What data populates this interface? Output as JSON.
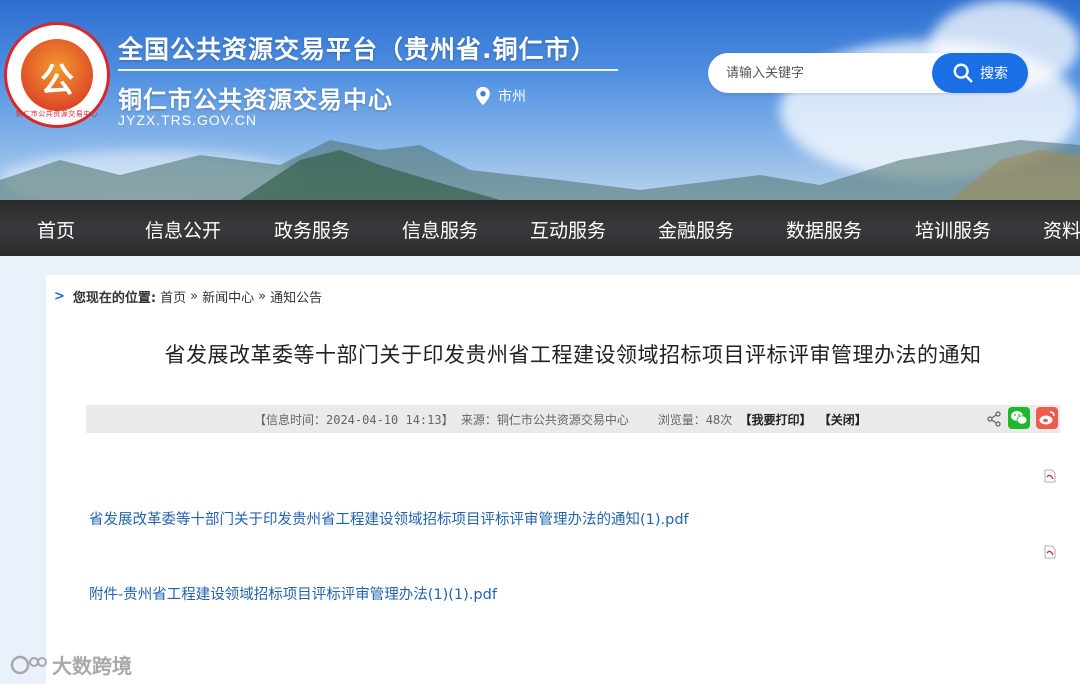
{
  "header": {
    "logo_char": "公",
    "logo_ring_text": "铜仁市公共资源交易中心",
    "title_main": "全国公共资源交易平台（贵州省.铜仁市）",
    "title_sub": "铜仁市公共资源交易中心",
    "domain": "JYZX.TRS.GOV.CN",
    "location_label": "市州",
    "search_placeholder": "请输入关键字",
    "search_button": "搜索"
  },
  "nav": {
    "items": [
      "首页",
      "信息公开",
      "政务服务",
      "信息服务",
      "互动服务",
      "金融服务",
      "数据服务",
      "培训服务",
      "资料"
    ]
  },
  "breadcrumb": {
    "label": "您现在的位置:",
    "items": [
      "首页",
      "新闻中心",
      "通知公告"
    ],
    "separator": "»"
  },
  "article": {
    "title": "省发展改革委等十部门关于印发贵州省工程建设领域招标项目评标评审管理办法的通知",
    "meta": {
      "time": "【信息时间：2024-04-10 14:13】",
      "source": "来源：铜仁市公共资源交易中心",
      "views": "浏览量：48次",
      "print": "【我要打印】",
      "close": "【关闭】"
    },
    "attachments": [
      "省发展改革委等十部门关于印发贵州省工程建设领域招标项目评标评审管理办法的通知(1).pdf",
      "附件-贵州省工程建设领域招标项目评标评审管理办法(1)(1).pdf"
    ]
  },
  "watermark": "大数跨境",
  "colors": {
    "nav_bg": "#2f2f31",
    "search_button": "#1a6fe4",
    "link": "#2463b0",
    "wechat": "#1fb82c",
    "weibo": "#ef5b4f"
  }
}
